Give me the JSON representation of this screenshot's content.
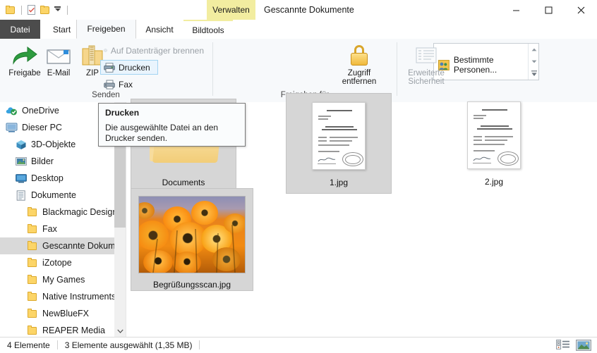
{
  "window": {
    "title": "Gescannte Dokumente",
    "context_tab": "Verwalten",
    "minimize": "–",
    "maximize": "☐",
    "close": "✕"
  },
  "quick_access": {
    "items": [
      {
        "name": "folder-icon",
        "label": ""
      },
      {
        "name": "properties-icon",
        "label": ""
      },
      {
        "name": "new-folder-icon",
        "label": ""
      },
      {
        "name": "customize-dropdown-icon",
        "label": ""
      }
    ]
  },
  "tabs": [
    {
      "id": "datei",
      "label": "Datei"
    },
    {
      "id": "start",
      "label": "Start"
    },
    {
      "id": "freigeben",
      "label": "Freigeben"
    },
    {
      "id": "ansicht",
      "label": "Ansicht"
    },
    {
      "id": "bildtools",
      "label": "Bildtools"
    }
  ],
  "ribbon": {
    "help_glyph": "?",
    "groups": [
      {
        "id": "senden",
        "label": "Senden",
        "big_buttons": [
          {
            "id": "freigabe",
            "label": "Freigabe",
            "icon": "share-arrow-icon"
          },
          {
            "id": "email",
            "label": "E-Mail",
            "icon": "envelope-icon"
          },
          {
            "id": "zip",
            "label": "ZIP",
            "icon": "zip-folder-icon"
          }
        ],
        "small_items": [
          {
            "id": "burn",
            "label": "Auf Datenträger brennen",
            "icon": "disc-icon",
            "disabled": true,
            "hovered": false
          },
          {
            "id": "print",
            "label": "Drucken",
            "icon": "printer-icon",
            "disabled": false,
            "hovered": true
          },
          {
            "id": "fax",
            "label": "Fax",
            "icon": "fax-icon",
            "disabled": false,
            "hovered": false
          }
        ]
      },
      {
        "id": "freigeben-fuer",
        "label": "Freigeben für",
        "gallery_value": "Bestimmte Personen...",
        "gallery_icon": "people-icon",
        "scroll_up": "▲",
        "scroll_down": "▼",
        "scroll_more": "▼",
        "buttons": [
          {
            "id": "zugriff-entfernen",
            "label_line1": "Zugriff",
            "label_line2": "entfernen",
            "icon": "lock-icon",
            "disabled": false
          },
          {
            "id": "erweiterte-sicherheit",
            "label_line1": "Erweiterte",
            "label_line2": "Sicherheit",
            "icon": "security-list-icon",
            "disabled": true
          }
        ]
      }
    ]
  },
  "tooltip": {
    "title": "Drucken",
    "body": "Die ausgewählte Datei an den Drucker senden."
  },
  "navigation": {
    "items": [
      {
        "id": "onedrive",
        "label": "OneDrive",
        "icon": "onedrive-cloud-icon",
        "indent": 8,
        "selected": false
      },
      {
        "id": "dieser-pc",
        "label": "Dieser PC",
        "icon": "computer-icon",
        "indent": 8,
        "selected": false
      },
      {
        "id": "3d-objekte",
        "label": "3D-Objekte",
        "icon": "3d-objects-icon",
        "indent": 22,
        "selected": false
      },
      {
        "id": "bilder",
        "label": "Bilder",
        "icon": "pictures-icon",
        "indent": 22,
        "selected": false
      },
      {
        "id": "desktop",
        "label": "Desktop",
        "icon": "desktop-icon",
        "indent": 22,
        "selected": false
      },
      {
        "id": "dokumente",
        "label": "Dokumente",
        "icon": "documents-icon",
        "indent": 22,
        "selected": false
      },
      {
        "id": "blackmagic-design",
        "label": "Blackmagic Design",
        "icon": "folder-icon",
        "indent": 38,
        "selected": false
      },
      {
        "id": "fax",
        "label": "Fax",
        "icon": "folder-icon",
        "indent": 38,
        "selected": false
      },
      {
        "id": "gescannte-dokumente",
        "label": "Gescannte Dokumente",
        "icon": "folder-icon",
        "indent": 38,
        "selected": true
      },
      {
        "id": "izotope",
        "label": "iZotope",
        "icon": "folder-icon",
        "indent": 38,
        "selected": false
      },
      {
        "id": "my-games",
        "label": "My Games",
        "icon": "folder-icon",
        "indent": 38,
        "selected": false
      },
      {
        "id": "native-instruments",
        "label": "Native Instruments",
        "icon": "folder-icon",
        "indent": 38,
        "selected": false
      },
      {
        "id": "newbluefx",
        "label": "NewBlueFX",
        "icon": "folder-icon",
        "indent": 38,
        "selected": false
      },
      {
        "id": "reaper-media",
        "label": "REAPER Media",
        "icon": "folder-icon",
        "indent": 38,
        "selected": false
      }
    ],
    "scroll_down_glyph": "⌄"
  },
  "files": [
    {
      "id": "documents",
      "label": "Documents",
      "type": "folder",
      "selected": true
    },
    {
      "id": "1jpg",
      "label": "1.jpg",
      "type": "document-scan",
      "selected": true
    },
    {
      "id": "2jpg",
      "label": "2.jpg",
      "type": "document-scan",
      "selected": false
    },
    {
      "id": "begruessungsscan",
      "label": "Begrüßungsscan.jpg",
      "type": "photo",
      "selected": true
    }
  ],
  "status": {
    "item_count": "4 Elemente",
    "selection": "3 Elemente ausgewählt (1,35 MB)"
  },
  "view_buttons": [
    {
      "id": "details-view",
      "name": "details-view-button"
    },
    {
      "id": "large-icons-view",
      "name": "large-icons-view-button"
    }
  ],
  "colors": {
    "context_tab_yellow": "#f2eda0",
    "file_tab_dark": "#4c4c4c",
    "ribbon_bg": "#f7f9fb",
    "selection_gray": "#d6d6d6",
    "accent_blue": "#1b8fd6"
  }
}
